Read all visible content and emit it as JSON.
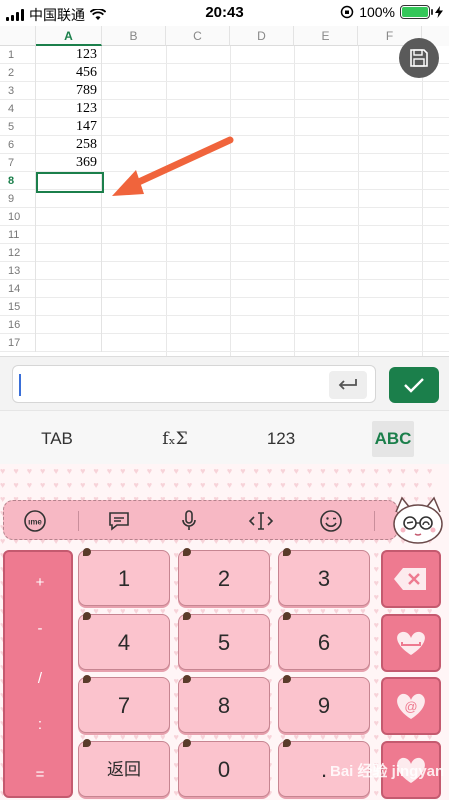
{
  "status_bar": {
    "carrier": "中国联通",
    "time": "20:43",
    "battery": "100%",
    "battery_level": 1.0
  },
  "sheet": {
    "columns": [
      "A",
      "B",
      "C",
      "D",
      "E",
      "F"
    ],
    "selected_column": "A",
    "row_numbers": [
      "1",
      "2",
      "3",
      "4",
      "5",
      "6",
      "7",
      "8",
      "9",
      "10",
      "11",
      "12",
      "13",
      "14",
      "15",
      "16",
      "17"
    ],
    "selected_row": "8",
    "column_a_values": [
      "123",
      "456",
      "789",
      "123",
      "147",
      "258",
      "369",
      "",
      "",
      "",
      "",
      "",
      "",
      "",
      "",
      "",
      ""
    ]
  },
  "formula_bar": {
    "value": ""
  },
  "mode_tabs": [
    "TAB",
    "fₓΣ",
    "123",
    "ABC"
  ],
  "active_mode": "ABC",
  "keyboard": {
    "toolbar_icons": [
      "ime-icon",
      "chat-icon",
      "microphone-icon",
      "cursor-move-icon",
      "emoji-icon"
    ],
    "side_symbols": [
      "+",
      "-",
      "/",
      ":",
      "="
    ],
    "keys": [
      "1",
      "2",
      "3",
      "4",
      "5",
      "6",
      "7",
      "8",
      "9",
      "返回",
      "0",
      "."
    ],
    "watermark": "Bai 经验 jingyan"
  },
  "colors": {
    "accent": "#1b7f4b",
    "keyboard_pink": "#fbc3cd",
    "keyboard_dark_pink": "#ee7a90",
    "arrow": "#f0643c"
  }
}
